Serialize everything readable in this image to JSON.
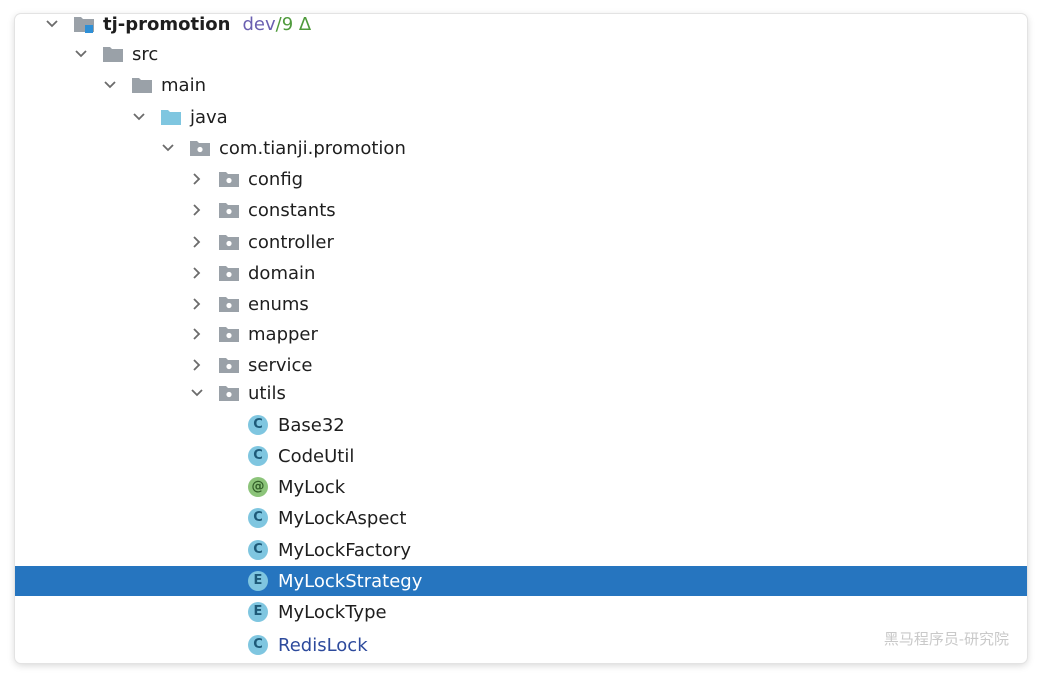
{
  "project": {
    "name": "tj-promotion",
    "branch": "dev",
    "branch_sep": " / ",
    "changes": "9 Δ"
  },
  "tree": {
    "src": "src",
    "main": "main",
    "java": "java",
    "package": "com.tianji.promotion",
    "folders": [
      "config",
      "constants",
      "controller",
      "domain",
      "enums",
      "mapper",
      "service",
      "utils"
    ],
    "files": [
      {
        "kind": "C",
        "name": "Base32"
      },
      {
        "kind": "C",
        "name": "CodeUtil"
      },
      {
        "kind": "@",
        "name": "MyLock"
      },
      {
        "kind": "C",
        "name": "MyLockAspect"
      },
      {
        "kind": "C",
        "name": "MyLockFactory"
      },
      {
        "kind": "E",
        "name": "MyLockStrategy"
      },
      {
        "kind": "E",
        "name": "MyLockType"
      },
      {
        "kind": "C",
        "name": "RedisLock"
      }
    ]
  },
  "selected_file": "MyLockStrategy",
  "watermark": "黑马程序员-研究院",
  "colors": {
    "selection": "#2675bf",
    "class_icon": "#7fc6e0",
    "annotation_icon": "#8cc47a",
    "branch": "#6a5fb0",
    "changes": "#4f9a3c"
  }
}
